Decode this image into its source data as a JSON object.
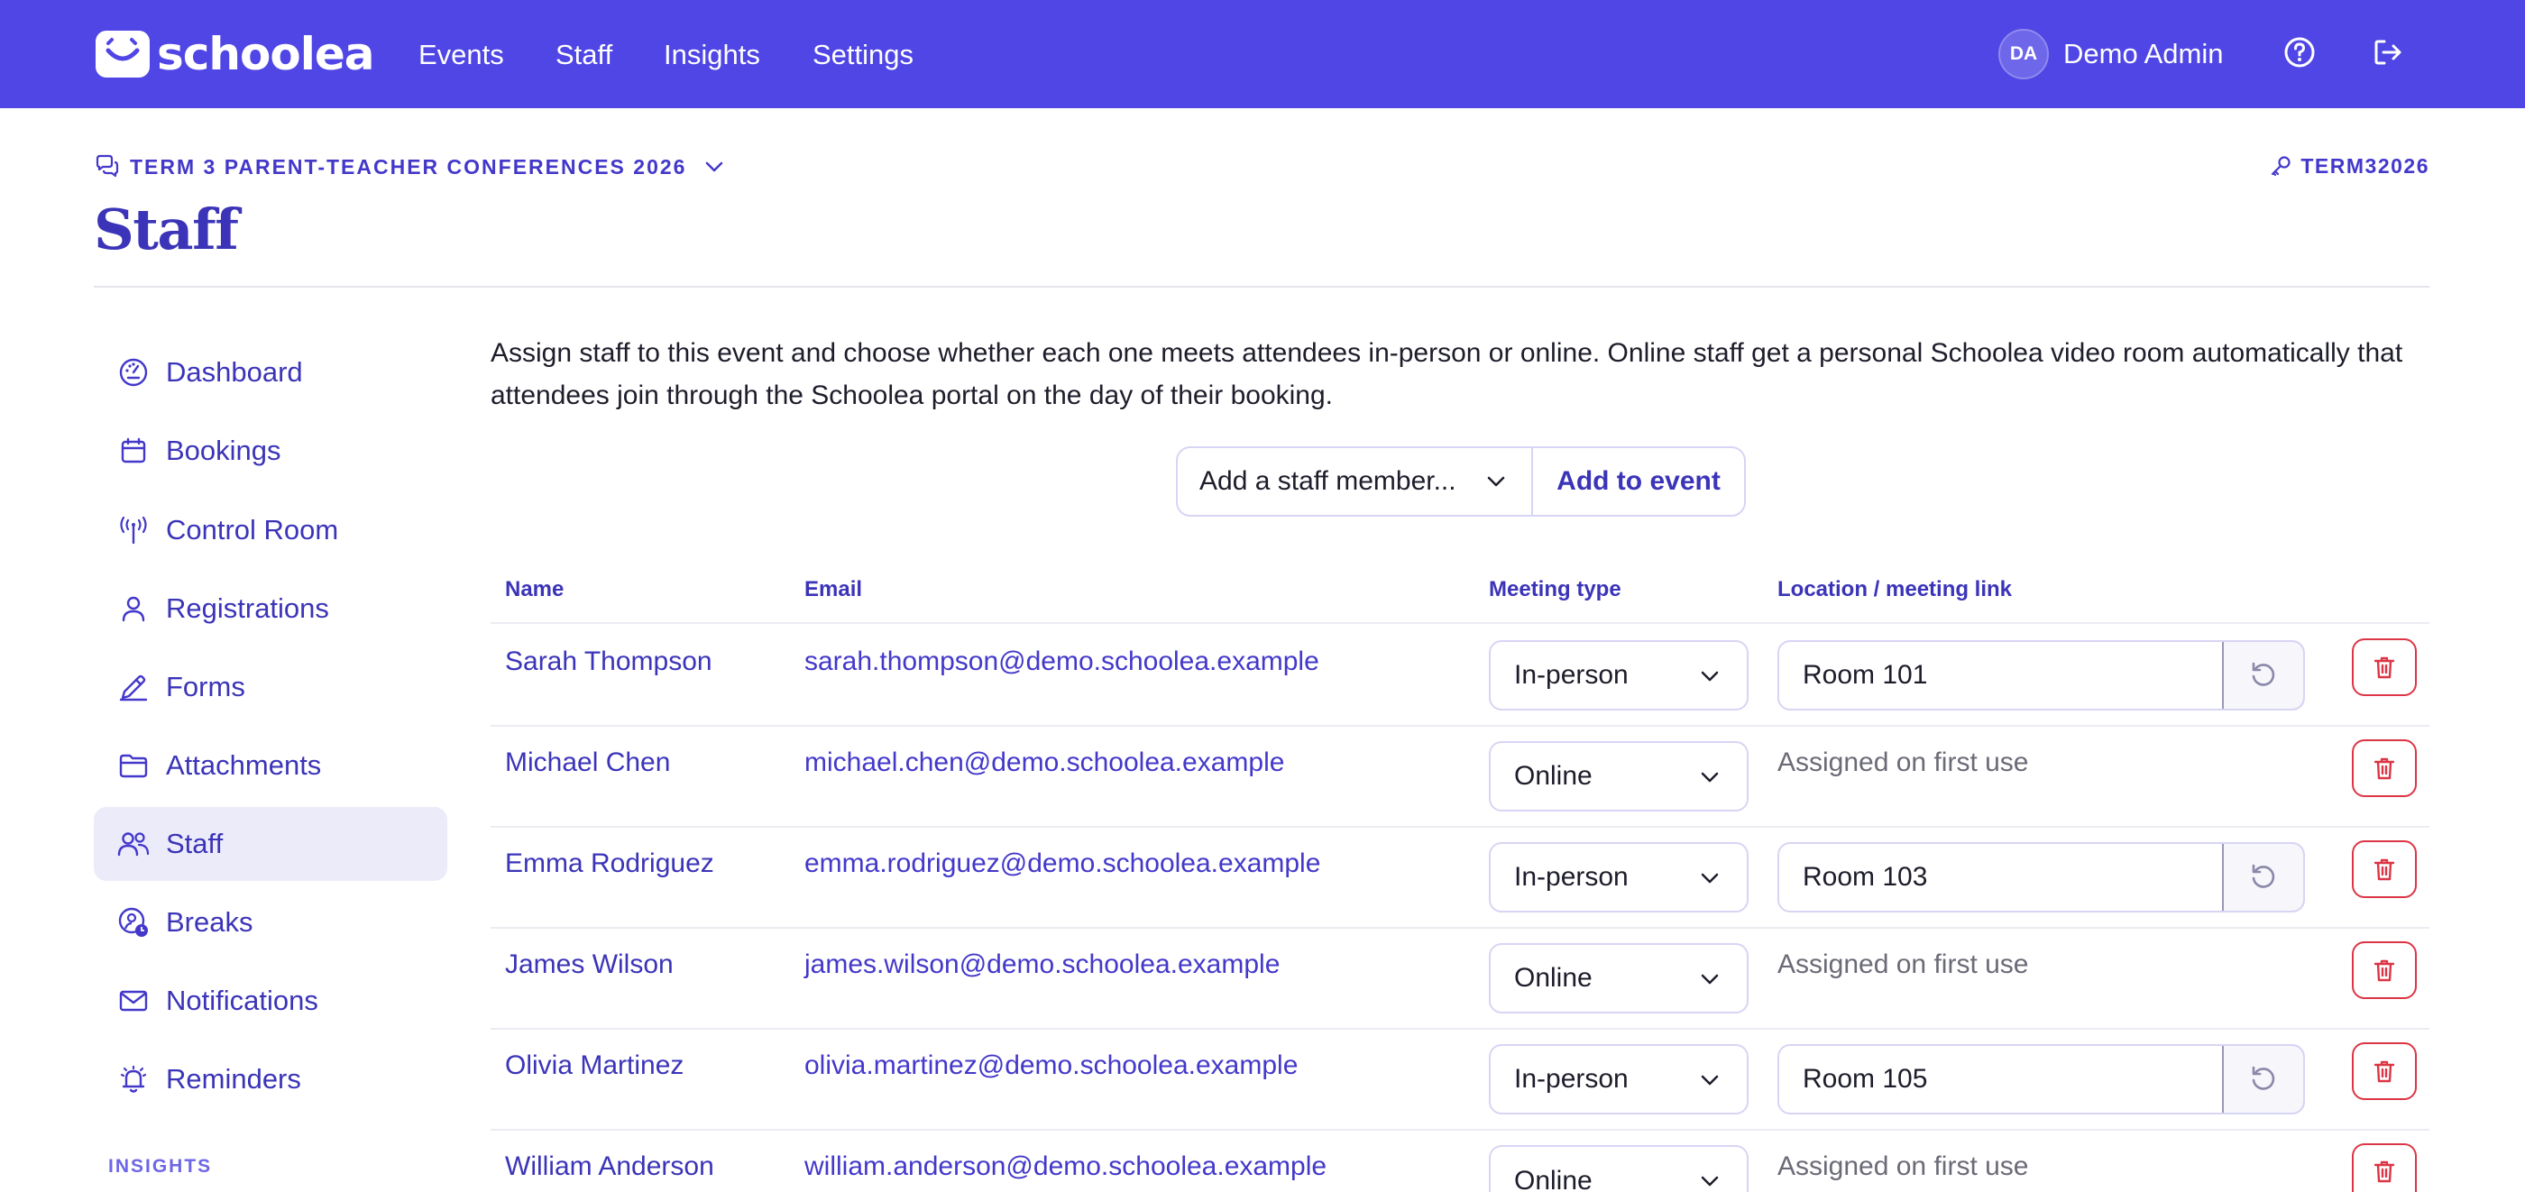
{
  "app": {
    "brand": "schoolea",
    "nav": [
      "Events",
      "Staff",
      "Insights",
      "Settings"
    ],
    "user": {
      "initials": "DA",
      "name": "Demo Admin"
    },
    "accent_color": "#4f46e5"
  },
  "event": {
    "name": "TERM 3 PARENT-TEACHER CONFERENCES 2026",
    "code": "TERM32026"
  },
  "page": {
    "title": "Staff"
  },
  "sidebar": {
    "items": [
      {
        "label": "Dashboard",
        "icon": "dashboard-gauge-icon"
      },
      {
        "label": "Bookings",
        "icon": "calendar-icon"
      },
      {
        "label": "Control Room",
        "icon": "broadcast-antenna-icon"
      },
      {
        "label": "Registrations",
        "icon": "person-icon"
      },
      {
        "label": "Forms",
        "icon": "pen-icon"
      },
      {
        "label": "Attachments",
        "icon": "folder-icon"
      },
      {
        "label": "Staff",
        "icon": "people-icon",
        "active": true
      },
      {
        "label": "Breaks",
        "icon": "user-clock-icon"
      },
      {
        "label": "Notifications",
        "icon": "envelope-icon"
      },
      {
        "label": "Reminders",
        "icon": "alarm-bell-icon"
      }
    ],
    "section_label": "INSIGHTS"
  },
  "intro": "Assign staff to this event and choose whether each one meets attendees in-person or online. Online staff get a personal Schoolea video room automatically that attendees join through the Schoolea portal on the day of their booking.",
  "add_staff": {
    "select_value": "Add a staff member...",
    "button_label": "Add to event"
  },
  "table": {
    "headers": [
      "Name",
      "Email",
      "Meeting type",
      "Location / meeting link"
    ],
    "online_placeholder": "Assigned on first use",
    "rows": [
      {
        "name": "Sarah Thompson",
        "email": "sarah.thompson@demo.schoolea.example",
        "meeting_type": "In-person",
        "location": "Room 101"
      },
      {
        "name": "Michael Chen",
        "email": "michael.chen@demo.schoolea.example",
        "meeting_type": "Online",
        "location": "Assigned on first use"
      },
      {
        "name": "Emma Rodriguez",
        "email": "emma.rodriguez@demo.schoolea.example",
        "meeting_type": "In-person",
        "location": "Room 103"
      },
      {
        "name": "James Wilson",
        "email": "james.wilson@demo.schoolea.example",
        "meeting_type": "Online",
        "location": "Assigned on first use"
      },
      {
        "name": "Olivia Martinez",
        "email": "olivia.martinez@demo.schoolea.example",
        "meeting_type": "In-person",
        "location": "Room 105"
      },
      {
        "name": "William Anderson",
        "email": "william.anderson@demo.schoolea.example",
        "meeting_type": "Online",
        "location": "Assigned on first use"
      }
    ]
  }
}
